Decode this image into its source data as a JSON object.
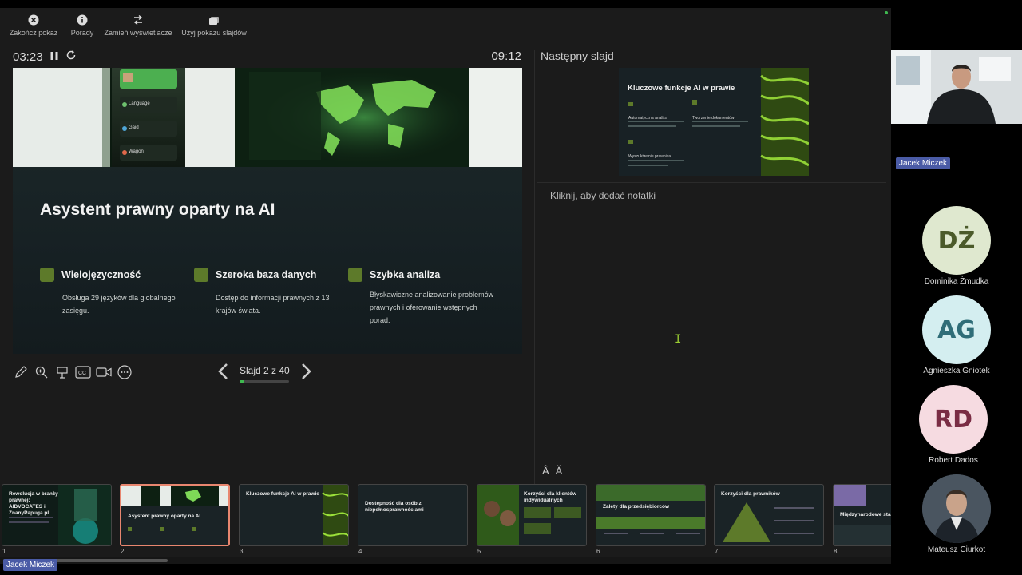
{
  "toolbar": {
    "items": [
      {
        "label": "Zakończ pokaz",
        "icon": "close-circle-icon"
      },
      {
        "label": "Porady",
        "icon": "info-icon"
      },
      {
        "label": "Zamień wyświetlacze",
        "icon": "swap-icon"
      },
      {
        "label": "Użyj pokazu slajdów",
        "icon": "slideshow-icon"
      }
    ]
  },
  "timer": {
    "elapsed": "03:23",
    "clock": "09:12"
  },
  "current_slide": {
    "title": "Asystent prawny oparty na AI",
    "photo_texts": [
      "Language",
      "Gaid",
      "Wagon"
    ],
    "features": [
      {
        "title": "Wielojęzyczność",
        "desc": "Obsługa 29 języków dla globalnego zasięgu."
      },
      {
        "title": "Szeroka baza danych",
        "desc": "Dostęp do informacji prawnych z 13 krajów świata."
      },
      {
        "title": "Szybka analiza",
        "desc": "Błyskawiczne analizowanie problemów prawnych i oferowanie wstępnych porad."
      }
    ]
  },
  "navigation": {
    "counter": "Slajd 2 z 40",
    "progress": 0.05
  },
  "next_slide": {
    "label": "Następny slajd",
    "title": "Kluczowe funkcje AI w prawie",
    "items": [
      "Automatyczna analiza",
      "Tworzenie dokumentów",
      "Wyszukiwanie prawnika"
    ]
  },
  "notes": {
    "placeholder": "Kliknij, aby dodać notatki"
  },
  "font_controls": {
    "increase": "Â",
    "decrease": "Ǎ"
  },
  "thumbnails": [
    {
      "num": "1",
      "title": "Rewolucja w branży prawnej: AIDVOCATES i ZnanyPapuga.pl"
    },
    {
      "num": "2",
      "title": "Asystent prawny oparty na AI"
    },
    {
      "num": "3",
      "title": "Kluczowe funkcje AI w prawie"
    },
    {
      "num": "4",
      "title": "Dostępność dla osób z niepełnosprawnościami"
    },
    {
      "num": "5",
      "title": "Korzyści dla klientów indywidualnych"
    },
    {
      "num": "6",
      "title": "Zalety dla przedsiębiorców"
    },
    {
      "num": "7",
      "title": "Korzyści dla prawników"
    },
    {
      "num": "8",
      "title": "Międzynarodowe stan"
    }
  ],
  "presenter_tag": "Jacek Miczek",
  "participants": {
    "video_name": "Jacek Miczek",
    "list": [
      {
        "initials": "DŻ",
        "name": "Dominika Żmudka",
        "bg": "#dfe8cf",
        "fg": "#4b5a2a"
      },
      {
        "initials": "AG",
        "name": "Agnieszka Gniotek",
        "bg": "#d4eef0",
        "fg": "#2f6d78"
      },
      {
        "initials": "RD",
        "name": "Robert Dados",
        "bg": "#f6dbe1",
        "fg": "#7a2c44"
      },
      {
        "initials": "",
        "name": "Mateusz Ciurkot",
        "bg": "#445566",
        "fg": "#ffffff"
      }
    ]
  },
  "colors": {
    "accent": "#3fb950",
    "active_thumb_border": "#e8866f",
    "slide_bullet": "#5d7a2a"
  }
}
